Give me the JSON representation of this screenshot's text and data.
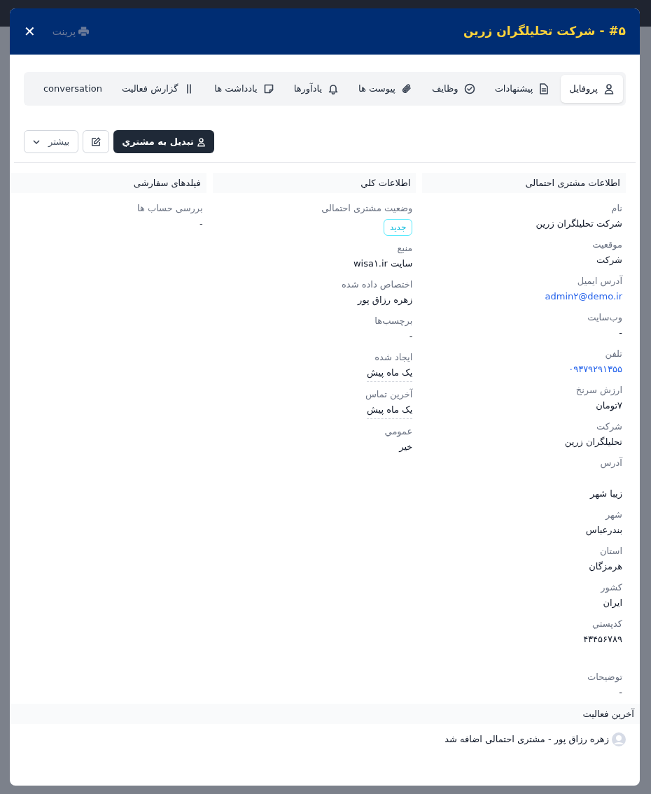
{
  "modal": {
    "title": "#۵ - شرکت تحلیلگران زرین",
    "print": "پرینت",
    "close": "✕"
  },
  "tabs": [
    {
      "label": "پروفایل",
      "selected": true
    },
    {
      "label": "پیشنهادات",
      "selected": false
    },
    {
      "label": "وظایف",
      "selected": false
    },
    {
      "label": "پیوست ها",
      "selected": false
    },
    {
      "label": "یادآورها",
      "selected": false
    },
    {
      "label": "یادداشت ها",
      "selected": false
    },
    {
      "label": "گزارش فعالیت",
      "selected": false
    },
    {
      "label": "conversation",
      "selected": false
    }
  ],
  "actions": {
    "convert": "تبدیل به مشتري",
    "more": "بیشتر"
  },
  "columns": [
    {
      "heading": "اطلاعات مشتری احتمالی",
      "fields": [
        {
          "kind": "text",
          "label": "نام",
          "value": "شرکت تحلیلگران زرین"
        },
        {
          "kind": "text",
          "label": "موقعیت",
          "value": "شرکت"
        },
        {
          "kind": "link",
          "label": "آدرس ایمیل",
          "value": "admin۲@demo.ir"
        },
        {
          "kind": "text",
          "label": "وب‌سایت",
          "value": "-"
        },
        {
          "kind": "link",
          "label": "تلفن",
          "value": "۰۹۳۷۹۲۹۱۳۵۵"
        },
        {
          "kind": "text",
          "label": "ارزش سرنخ",
          "value": "۷تومان"
        },
        {
          "kind": "text",
          "label": "شرکت",
          "value": "تحلیلگران زرین"
        },
        {
          "kind": "block",
          "label": "آدرس",
          "value": "زیبا شهر"
        },
        {
          "kind": "text",
          "label": "شهر",
          "value": "بندرعباس"
        },
        {
          "kind": "text",
          "label": "استان",
          "value": "هرمزگان"
        },
        {
          "kind": "text",
          "label": "کشور",
          "value": "ایران"
        },
        {
          "kind": "text",
          "label": "کدپستي",
          "value": "۴۳۴۵۶۷۸۹"
        },
        {
          "kind": "spaced",
          "label": "توضیحات",
          "value": "-"
        }
      ]
    },
    {
      "heading": "اطلاعات کلي",
      "fields": [
        {
          "kind": "badge",
          "label": "وضعیت مشتری احتمالی",
          "value": "جدید"
        },
        {
          "kind": "text",
          "label": "منبع",
          "value": "سایت wisa۱.ir"
        },
        {
          "kind": "text",
          "label": "اختصاص داده شده",
          "value": "زهره رزاق پور"
        },
        {
          "kind": "text",
          "label": "برچسب‌ها",
          "value": "-"
        },
        {
          "kind": "date",
          "label": "ایجاد شده",
          "value": "یک ماه پیش"
        },
        {
          "kind": "date",
          "label": "آخرین تماس",
          "value": "یک ماه پیش"
        },
        {
          "kind": "text",
          "label": "عمومي",
          "value": "خیر"
        }
      ]
    },
    {
      "heading": "فیلدهای سفارشی",
      "fields": [
        {
          "kind": "text",
          "label": "بررسی حساب ها",
          "value": "-"
        }
      ]
    }
  ],
  "activity": {
    "heading": "آخرین فعالیت",
    "items": [
      "زهره رزاق پور - مشتری احتمالی اضافه شد"
    ]
  }
}
